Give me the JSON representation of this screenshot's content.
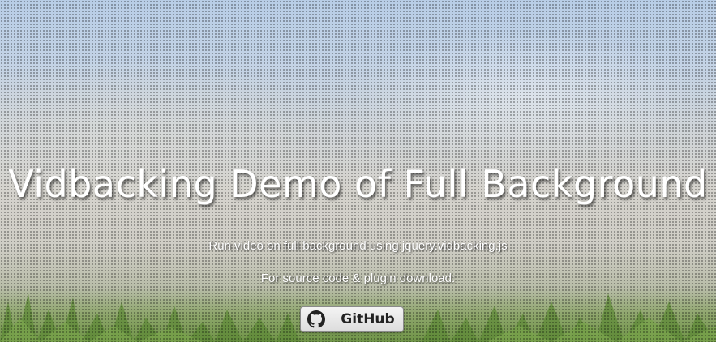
{
  "hero": {
    "title": "Vidbacking Demo of Full Background",
    "subtitle": "Run video on full background using jquery.vidbacking.js",
    "source_text": "For source code & plugin download:"
  },
  "github_button": {
    "icon": "github-icon",
    "label": "GitHub"
  },
  "colors": {
    "text": "#ffffff",
    "button_bg": "#e6e6e6",
    "button_text": "#222222"
  }
}
